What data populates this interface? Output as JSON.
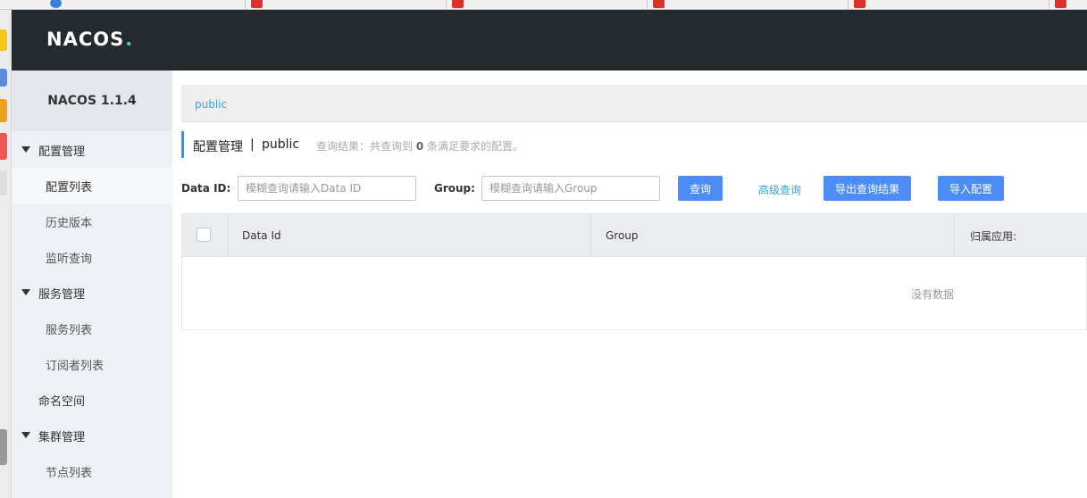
{
  "header": {
    "logo_main": "NACOS",
    "logo_dot": "."
  },
  "sidebar": {
    "brand": "NACOS 1.1.4",
    "config_group": "配置管理",
    "config_list": "配置列表",
    "history": "历史版本",
    "listen_query": "监听查询",
    "service_group": "服务管理",
    "service_list": "服务列表",
    "subscriber_list": "订阅者列表",
    "namespace": "命名空间",
    "cluster_group": "集群管理",
    "node_list": "节点列表"
  },
  "namespace_bar": {
    "current": "public"
  },
  "page_title": {
    "main": "配置管理",
    "separator": "|",
    "namespace": "public"
  },
  "summary": {
    "prefix": "查询结果：共查询到",
    "count": "0",
    "suffix": "条满足要求的配置。"
  },
  "search": {
    "dataid_label": "Data ID:",
    "dataid_placeholder": "模糊查询请输入Data ID",
    "dataid_value": "",
    "group_label": "Group:",
    "group_placeholder": "模糊查询请输入Group",
    "group_value": "",
    "query_button": "查询",
    "advanced_link": "高级查询",
    "export_button": "导出查询结果",
    "import_button": "导入配置"
  },
  "table": {
    "columns": [
      "Data Id",
      "Group",
      "归属应用:"
    ],
    "empty_text": "没有数据"
  },
  "colors": {
    "accent": "#4c8cf5",
    "link": "#33a3dc",
    "header_bg": "#252a2f",
    "logo_dot": "#33cde5"
  }
}
